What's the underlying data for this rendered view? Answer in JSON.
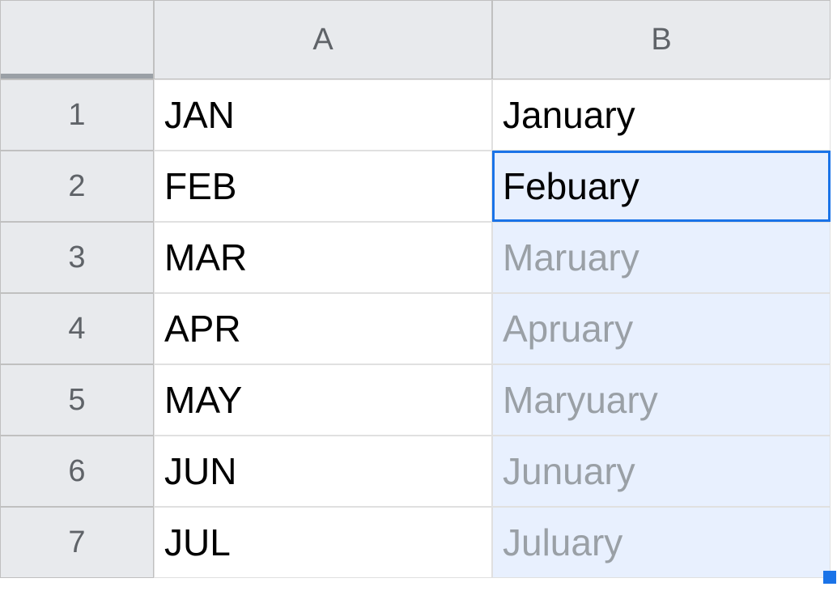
{
  "columns": [
    "A",
    "B"
  ],
  "rows": [
    "1",
    "2",
    "3",
    "4",
    "5",
    "6",
    "7"
  ],
  "data": {
    "A": [
      "JAN",
      "FEB",
      "MAR",
      "APR",
      "MAY",
      "JUN",
      "JUL"
    ],
    "B": [
      "January",
      "Febuary",
      "Maruary",
      "Apruary",
      "Maryuary",
      "Junuary",
      "Juluary"
    ]
  },
  "active_cell": "B2",
  "suggestion_range": {
    "start": "B3",
    "end": "B7"
  }
}
